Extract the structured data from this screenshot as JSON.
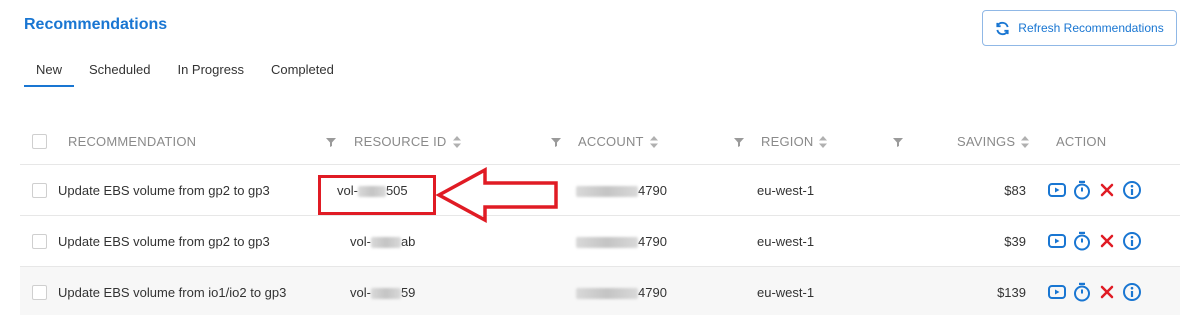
{
  "page": {
    "title": "Recommendations"
  },
  "toolbar": {
    "refresh_label": "Refresh Recommendations"
  },
  "tabs": [
    {
      "label": "New",
      "active": true
    },
    {
      "label": "Scheduled",
      "active": false
    },
    {
      "label": "In Progress",
      "active": false
    },
    {
      "label": "Completed",
      "active": false
    }
  ],
  "table": {
    "headers": {
      "recommendation": "RECOMMENDATION",
      "resource_id": "RESOURCE ID",
      "account": "ACCOUNT",
      "region": "REGION",
      "savings": "SAVINGS",
      "action": "ACTION"
    },
    "rows": [
      {
        "recommendation": "Update EBS volume from gp2 to gp3",
        "resource_prefix": "vol-",
        "resource_suffix": "505",
        "account_suffix": "4790",
        "region": "eu-west-1",
        "savings": "$83"
      },
      {
        "recommendation": "Update EBS volume from gp2 to gp3",
        "resource_prefix": "vol-",
        "resource_suffix": "ab",
        "account_suffix": "4790",
        "region": "eu-west-1",
        "savings": "$39"
      },
      {
        "recommendation": "Update EBS volume from io1/io2 to gp3",
        "resource_prefix": "vol-",
        "resource_suffix": "59",
        "account_suffix": "4790",
        "region": "eu-west-1",
        "savings": "$139"
      }
    ]
  },
  "colors": {
    "accent": "#1976d2",
    "annotation": "#e01b24",
    "action_delete": "#e01b24"
  },
  "icons": {
    "refresh": "refresh-icon",
    "execute": "play-icon",
    "schedule": "timer-icon",
    "dismiss": "close-icon",
    "info": "info-icon",
    "filter": "filter-icon",
    "sort": "sort-icon"
  }
}
